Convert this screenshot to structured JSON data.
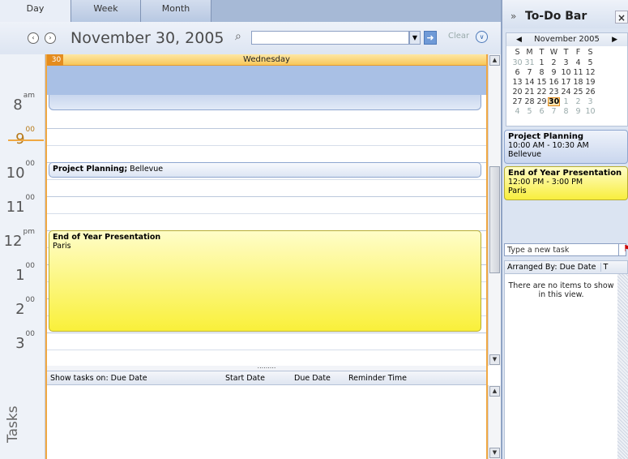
{
  "tabs": [
    {
      "label": "Day"
    },
    {
      "label": "Week"
    },
    {
      "label": "Month"
    }
  ],
  "nav": {
    "prev": "‹",
    "next": "›",
    "date": "November 30, 2005",
    "search_placeholder": "",
    "clear_label": "Clear"
  },
  "icons": {
    "prev": "back-circle-icon",
    "next": "forward-circle-icon",
    "search": "search-icon",
    "go": "arrow-right-icon",
    "collapse": "chevron-down-icon"
  },
  "day": {
    "number": "30",
    "weekday": "Wednesday"
  },
  "times": [
    {
      "h": "8",
      "s": "am"
    },
    {
      "h": "9",
      "s": "00"
    },
    {
      "h": "10",
      "s": "00"
    },
    {
      "h": "11",
      "s": "00"
    },
    {
      "h": "12",
      "s": "pm"
    },
    {
      "h": "1",
      "s": "00"
    },
    {
      "h": "2",
      "s": "00"
    },
    {
      "h": "3",
      "s": "00"
    }
  ],
  "appointments": [
    {
      "title": "Project Planning;",
      "location": "Bellevue"
    },
    {
      "title": "End of Year Presentation",
      "location": "Paris"
    }
  ],
  "tasks": {
    "side_label": "Tasks",
    "columns": [
      "Show tasks on: Due Date",
      "Start Date",
      "Due Date",
      "Reminder Time"
    ]
  },
  "todo_bar": {
    "title": "To-Do Bar",
    "calendar": {
      "month": "November 2005",
      "weekdays": [
        "S",
        "M",
        "T",
        "W",
        "T",
        "F",
        "S"
      ],
      "weeks": [
        [
          "30",
          "31",
          "1",
          "2",
          "3",
          "4",
          "5"
        ],
        [
          "6",
          "7",
          "8",
          "9",
          "10",
          "11",
          "12"
        ],
        [
          "13",
          "14",
          "15",
          "16",
          "17",
          "18",
          "19"
        ],
        [
          "20",
          "21",
          "22",
          "23",
          "24",
          "25",
          "26"
        ],
        [
          "27",
          "28",
          "29",
          "30",
          "1",
          "2",
          "3"
        ],
        [
          "4",
          "5",
          "6",
          "7",
          "8",
          "9",
          "10"
        ]
      ]
    },
    "appointments": [
      {
        "title": "Project Planning",
        "time": "10:00 AM - 10:30 AM",
        "location": "Bellevue"
      },
      {
        "title": "End of Year Presentation",
        "time": "12:00 PM - 3:00 PM",
        "location": "Paris"
      }
    ],
    "new_task_placeholder": "Type a new task",
    "arranged_by": "Arranged By: Due Date",
    "arranged_col": "T",
    "empty_message": "There are no items to show in this view."
  },
  "colors": {
    "accent": "#f0a843",
    "appointment_yellow": "#f9f03a",
    "allday_blue": "#a9c0e5"
  }
}
